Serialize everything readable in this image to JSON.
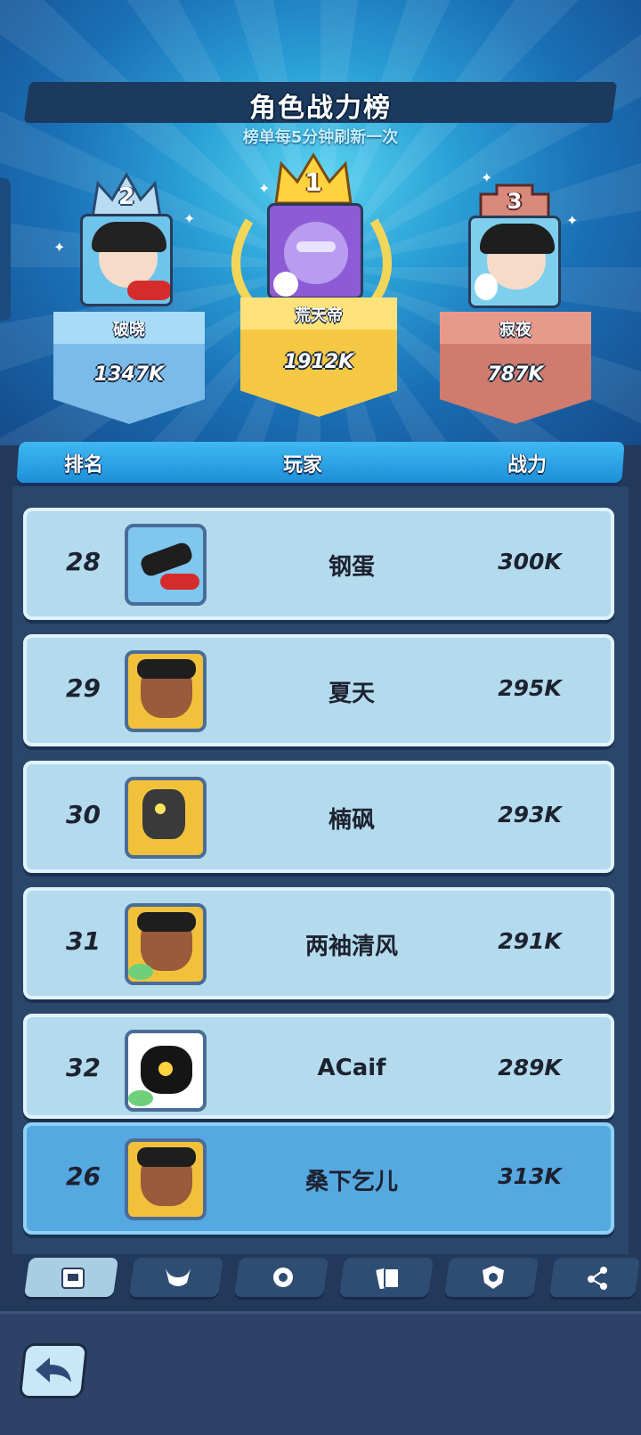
{
  "header": {
    "title": "角色战力榜",
    "subtitle": "榜单每5分钟刷新一次"
  },
  "podium": [
    {
      "rank": "2",
      "name": "破晓",
      "power": "1347K",
      "color": "#6db5e8"
    },
    {
      "rank": "1",
      "name": "荒天帝",
      "power": "1912K",
      "color": "#f2c94c"
    },
    {
      "rank": "3",
      "name": "寂夜",
      "power": "787K",
      "color": "#d07a6e"
    }
  ],
  "table": {
    "headers": [
      "排名",
      "玩家",
      "战力"
    ],
    "rows": [
      {
        "rank": "28",
        "name": "钢蛋",
        "power": "300K"
      },
      {
        "rank": "29",
        "name": "夏天",
        "power": "295K"
      },
      {
        "rank": "30",
        "name": "楠砜",
        "power": "293K"
      },
      {
        "rank": "31",
        "name": "两袖清风",
        "power": "291K"
      },
      {
        "rank": "32",
        "name": "ACaif",
        "power": "289K"
      }
    ],
    "self": {
      "rank": "26",
      "name": "桑下乞儿",
      "power": "313K"
    }
  },
  "nav": {
    "icons": [
      "character-tab-icon",
      "bull-tab-icon",
      "gem-tab-icon",
      "cards-tab-icon",
      "shield-tab-icon",
      "network-tab-icon"
    ],
    "active_index": 0
  },
  "back_button_icon": "back-arrow-icon"
}
